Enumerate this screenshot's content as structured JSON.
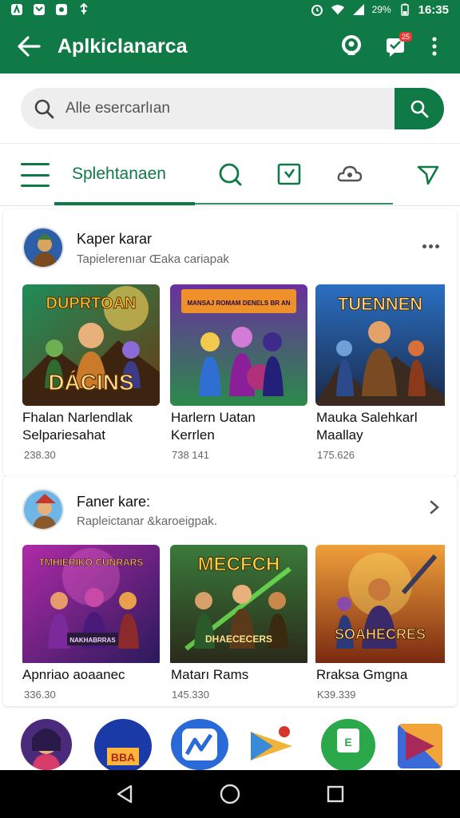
{
  "status_bar": {
    "time": "16:35",
    "battery": "29%",
    "icons": [
      "notification-icon",
      "mail-icon",
      "camera-icon",
      "usb-icon",
      "alarm-icon",
      "wifi-icon",
      "signal-icon"
    ]
  },
  "app_bar": {
    "title": "Aplkiclanarca",
    "notification_badge": "25",
    "colors": {
      "primary": "#0f7a45",
      "badge": "#e53935"
    }
  },
  "search": {
    "placeholder": "Alle esercarlıan"
  },
  "tabs": {
    "active_label": "Splehtanaen",
    "icons": [
      "menu-icon",
      "search-tab-icon",
      "download-tab-icon",
      "cloud-tab-icon",
      "send-tab-icon"
    ]
  },
  "sections": [
    {
      "title": "Kaper karar",
      "subtitle": "Tapielerenıar Œaka cariapak",
      "games": [
        {
          "art_text": "DUPRTOAN",
          "art_text_2": "DÁCINS",
          "title_line1": "Fhalan Narlendlak",
          "title_line2": "Selpariesahat",
          "count": "238.30"
        },
        {
          "art_text": "MANSAJ ROMAM DENELS BR AN",
          "title_line1": "Harlern Uatan",
          "title_line2": "Kerrlen",
          "count": "738 141"
        },
        {
          "art_text": "TUENNEN",
          "title_line1": "Mauka Salehkarl",
          "title_line2": "Maallay",
          "count": "175.626"
        }
      ]
    },
    {
      "title": "Faner kare:",
      "subtitle": "Rapleictanar &karoeigpak.",
      "games": [
        {
          "art_text": "TMHIERIKO CUNRARS",
          "art_text_2": "NAKHABRRAS",
          "title_line1": "Apnriao aoaanec",
          "title_line2": "",
          "count": "336.30"
        },
        {
          "art_text": "MECFCH",
          "art_text_2": "DHAECECERS",
          "title_line1": "Matarı Rams",
          "title_line2": "",
          "count": "145.330"
        },
        {
          "art_text": "SOAHECRES",
          "title_line1": "Rraksa Gmgna",
          "title_line2": "",
          "count": "K39.339"
        }
      ]
    }
  ],
  "bottom_apps": {
    "app2_text": "BBA",
    "app5_text": "E"
  }
}
